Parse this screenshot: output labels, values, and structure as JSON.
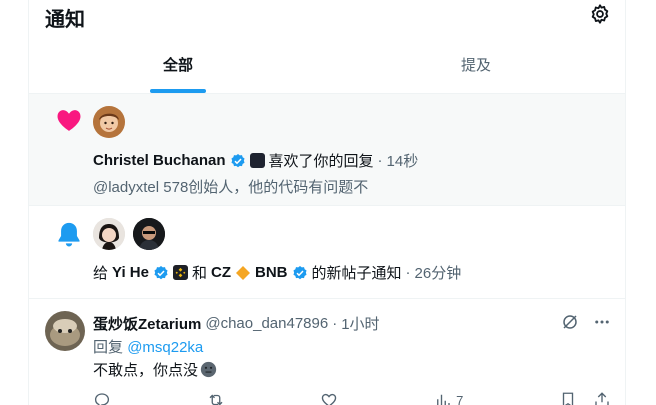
{
  "header": {
    "title": "通知"
  },
  "tabs": [
    {
      "label": "全部",
      "active": true
    },
    {
      "label": "提及",
      "active": false
    }
  ],
  "notifications": [
    {
      "type": "like",
      "icon": "heart-icon",
      "user": "Christel Buchanan",
      "action": "喜欢了你的回复",
      "time": "14秒",
      "snippet": "@ladyxtel 578创始人，他的代码有问题不"
    },
    {
      "type": "subscribe",
      "icon": "bell-icon",
      "prefix": "给",
      "user1": "Yi He",
      "join": "和",
      "user2": "CZ",
      "user2_suffix": "BNB",
      "action": "的新帖子通知",
      "time": "26分钟"
    }
  ],
  "post": {
    "name": "蛋炒饭Zetarium",
    "handle": "@chao_dan47896",
    "time": "1小时",
    "reply_prefix": "回复",
    "reply_handle": "@msq22ka",
    "text": "不敢点，你点没",
    "actions": {
      "views": "7"
    }
  },
  "colors": {
    "accent": "#1d9bf0",
    "like": "#f91880",
    "binance": "#f0b90b"
  }
}
